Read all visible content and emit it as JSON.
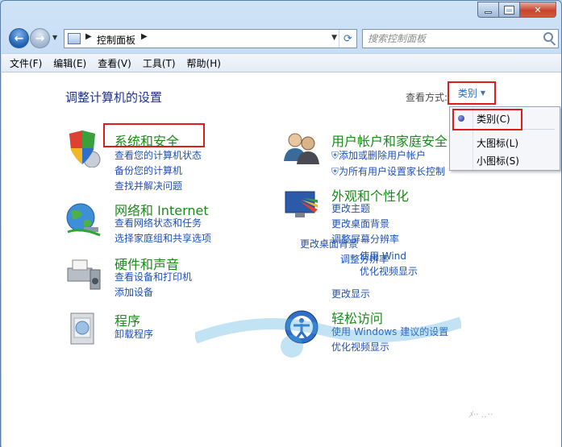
{
  "window": {
    "caption_buttons": [
      "minimize",
      "maximize",
      "close"
    ],
    "close_symbol": "✕"
  },
  "nav": {
    "address_text": "控制面板",
    "search_placeholder": "搜索控制面板"
  },
  "menu": [
    "文件(F)",
    "编辑(E)",
    "查看(V)",
    "工具(T)",
    "帮助(H)"
  ],
  "content": {
    "title": "调整计算机的设置",
    "view_by_label": "查看方式:",
    "view_by_value": "类别"
  },
  "categories": [
    {
      "title": "系统和安全",
      "links": [
        "查看您的计算机状态",
        "备份您的计算机",
        "查找并解决问题"
      ],
      "icon": "shield-icon"
    },
    {
      "title": "网络和 Internet",
      "links": [
        "查看网络状态和任务",
        "选择家庭组和共享选项"
      ],
      "icon": "network-globe-icon"
    },
    {
      "title": "硬件和声音",
      "links": [
        "查看设备和打印机",
        "添加设备"
      ],
      "icon": "printer-icon"
    },
    {
      "title": "程序",
      "links": [
        "卸载程序"
      ],
      "icon": "programs-icon"
    },
    {
      "title": "用户帐户和家庭安全",
      "links": [
        "添加或删除用户帐户",
        "为所有用户设置家长控制"
      ],
      "icon": "users-icon"
    },
    {
      "title": "外观和个性化",
      "links": [
        "更改主题",
        "更改桌面背景",
        "调整屏幕分辨率"
      ],
      "icon": "appearance-icon"
    },
    {
      "title": "轻松访问",
      "links": [
        "使用 Windows 建议的设置",
        "优化视频显示"
      ],
      "icon": "ease-access-icon"
    }
  ],
  "dropdown": {
    "items": [
      "类别(C)",
      "大图标(L)",
      "小图标(S)"
    ],
    "selected": 0
  },
  "ghost_text": [
    "更改桌面背景",
    "调整分辨率",
    "使用 Wind",
    "优化视频显示",
    "更改显示"
  ],
  "colors": {
    "accent": "#1f6cc9",
    "category_title": "#1a8a1a",
    "link": "#1f4fb5",
    "highlight_box": "#e01b1b"
  }
}
